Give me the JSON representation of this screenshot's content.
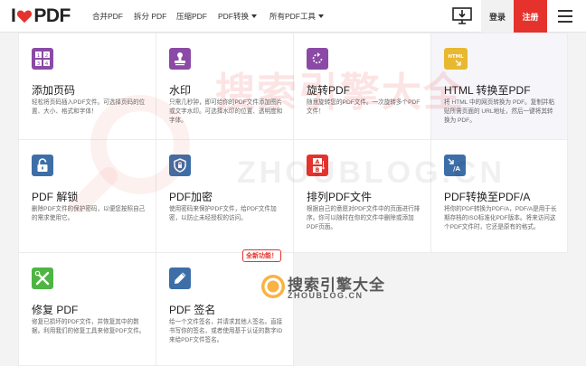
{
  "header": {
    "logo_left": "I",
    "logo_right": "PDF",
    "nav": [
      "合并PDF",
      "拆分 PDF",
      "压缩PDF",
      "PDF转换",
      "所有PDF工具"
    ],
    "login": "登录",
    "register": "注册"
  },
  "tools": [
    {
      "title": "添加页码",
      "desc": "轻松将页码插入PDF文件。可选择页码的位置、大小、格式和字体！",
      "icon": "page-numbers-icon",
      "color": "#8b4aa5"
    },
    {
      "title": "水印",
      "desc": "只需几秒钟，即可给你的PDF文件添加图片或文字水印。可选择水印的位置、透明度和字体。",
      "icon": "watermark-stamp-icon",
      "color": "#8b4aa5"
    },
    {
      "title": "旋转PDF",
      "desc": "随意旋转您的PDF文件。一次旋转多个PDF文件！",
      "icon": "rotate-icon",
      "color": "#8b4aa5"
    },
    {
      "title": "HTML 转换至PDF",
      "desc": "将 HTML 中的网页转换为 PDF。复制并粘贴所需页面的 URL地址，然后一键将其转换为 PDF。",
      "icon": "html-to-pdf-icon",
      "color": "#e8b830"
    },
    {
      "title": "PDF 解锁",
      "desc": "删除PDF文件的保护密码，以便您按照自己的需求使用它。",
      "icon": "unlock-icon",
      "color": "#3d6ea8"
    },
    {
      "title": "PDF加密",
      "desc": "使用密码来保护PDF文件，给PDF文件加密，以防止未经授权的访问。",
      "icon": "shield-icon",
      "color": "#3d6ea8"
    },
    {
      "title": "排列PDF文件",
      "desc": "根据自己的意愿对PDF文件中的页面进行排序。你可以随时在你的文件中删除或添加PDF页面。",
      "icon": "organize-pages-icon",
      "color": "#e5322d"
    },
    {
      "title": "PDF转换至PDF/A",
      "desc": "将你的PDF转换为PDF/A，PDF/A是用于长期存档的ISO标准化PDF版本。将来访问这个PDF文件时，它还是原有的格式。",
      "icon": "pdfa-icon",
      "color": "#3d6ea8"
    },
    {
      "title": "修复 PDF",
      "desc": "修复已损坏的PDF文件，并恢复其中的数据。利用我们的修复工具来修复PDF文件。",
      "icon": "repair-tools-icon",
      "color": "#4eb543"
    },
    {
      "title": "PDF 签名",
      "desc": "给一个文件签名，并请求其他人签名。直接书写你的签名，或者使用基于认证的数字ID来给PDF文件签名。",
      "icon": "signature-pen-icon",
      "color": "#3d6ea8",
      "badge": "全新功能！"
    }
  ],
  "watermark": {
    "big_cn": "搜索引擎大全",
    "big_en": "ZHOUBLOG.CN",
    "small_cn": "搜索引擎大全",
    "small_en": "ZHOUBLOG.CN"
  }
}
